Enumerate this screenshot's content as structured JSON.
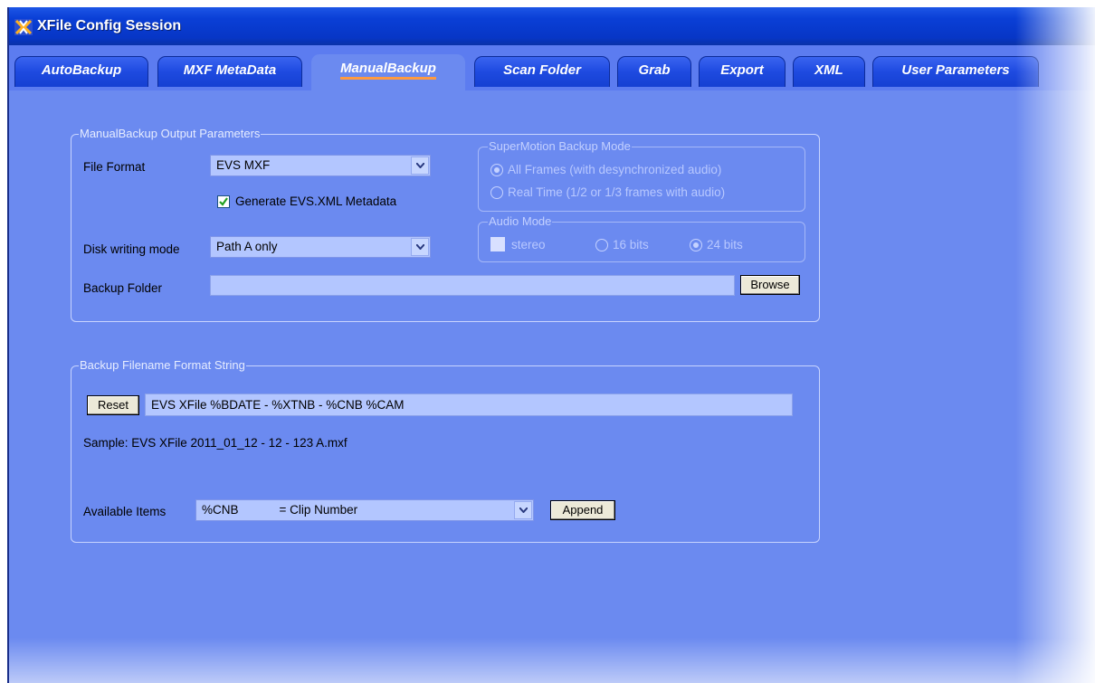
{
  "window": {
    "title": "XFile Config Session"
  },
  "tabs": [
    {
      "label": "AutoBackup"
    },
    {
      "label": "MXF MetaData"
    },
    {
      "label": "ManualBackup"
    },
    {
      "label": "Scan Folder"
    },
    {
      "label": "Grab"
    },
    {
      "label": "Export"
    },
    {
      "label": "XML"
    },
    {
      "label": "User Parameters"
    }
  ],
  "active_tab": "ManualBackup",
  "output_params": {
    "legend": "ManualBackup Output Parameters",
    "file_format_label": "File Format",
    "file_format_value": "EVS MXF",
    "generate_xml_label": "Generate EVS.XML Metadata",
    "generate_xml_checked": true,
    "disk_mode_label": "Disk writing mode",
    "disk_mode_value": "Path A only",
    "backup_folder_label": "Backup Folder",
    "backup_folder_value": "",
    "browse_label": "Browse"
  },
  "supermotion": {
    "legend": "SuperMotion Backup Mode",
    "options": [
      {
        "label": "All Frames (with desynchronized audio)",
        "selected": true
      },
      {
        "label": "Real Time (1/2 or 1/3 frames with audio)",
        "selected": false
      }
    ]
  },
  "audio_mode": {
    "legend": "Audio Mode",
    "stereo_label": "stereo",
    "options": [
      {
        "label": "16 bits",
        "selected": false
      },
      {
        "label": "24 bits",
        "selected": true
      }
    ]
  },
  "filename_format": {
    "legend": "Backup Filename Format String",
    "reset_label": "Reset",
    "format_value": "EVS XFile %BDATE - %XTNB - %CNB %CAM",
    "sample_text": "Sample: EVS XFile 2011_01_12 - 12 - 123 A.mxf",
    "available_label": "Available Items",
    "available_value": "%CNB            = Clip Number",
    "append_label": "Append"
  },
  "colors": {
    "panel": "#6b8af0",
    "titlebar": "#0a3fd6",
    "tab": "#1e4ae0",
    "active_tab_underline": "#ff9a40"
  }
}
